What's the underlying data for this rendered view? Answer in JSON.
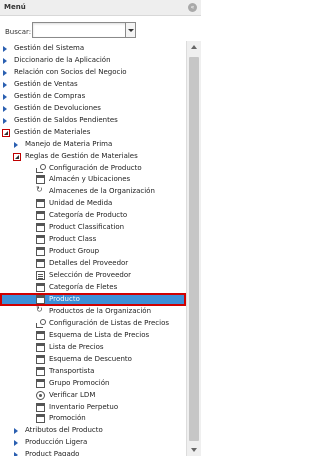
{
  "panel": {
    "title": "Menú",
    "collapse_icon": "«"
  },
  "search": {
    "label": "Buscar:",
    "value": ""
  },
  "tree": [
    {
      "label": "Gestión del Sistema",
      "kind": "folder",
      "level": 0,
      "icon": "arrow-right"
    },
    {
      "label": "Diccionario de la Aplicación",
      "kind": "folder",
      "level": 0,
      "icon": "arrow-right"
    },
    {
      "label": "Relación con Socios del Negocio",
      "kind": "folder",
      "level": 0,
      "icon": "arrow-right"
    },
    {
      "label": "Gestión de Ventas",
      "kind": "folder",
      "level": 0,
      "icon": "arrow-right"
    },
    {
      "label": "Gestión de Compras",
      "kind": "folder",
      "level": 0,
      "icon": "arrow-right"
    },
    {
      "label": "Gestión de Devoluciones",
      "kind": "folder",
      "level": 0,
      "icon": "arrow-right"
    },
    {
      "label": "Gestión de Saldos Pendientes",
      "kind": "folder",
      "level": 0,
      "icon": "arrow-right"
    },
    {
      "label": "Gestión de Materiales",
      "kind": "folder-open",
      "level": 0,
      "icon": "arrow-down"
    },
    {
      "label": "Manejo de Materia Prima",
      "kind": "folder",
      "level": 1,
      "icon": "arrow-right"
    },
    {
      "label": "Reglas de Gestión de Materiales",
      "kind": "folder-open",
      "level": 1,
      "icon": "arrow-down"
    },
    {
      "label": "Configuración de Producto",
      "kind": "process",
      "level": 2,
      "icon": "process2"
    },
    {
      "label": "Almacén y Ubicaciones",
      "kind": "window",
      "level": 2,
      "icon": "window"
    },
    {
      "label": "Almacenes de la Organización",
      "kind": "window",
      "level": 2,
      "icon": "process"
    },
    {
      "label": "Unidad de Medida",
      "kind": "window",
      "level": 2,
      "icon": "window"
    },
    {
      "label": "Categoría de Producto",
      "kind": "window",
      "level": 2,
      "icon": "window"
    },
    {
      "label": "Product Classification",
      "kind": "window",
      "level": 2,
      "icon": "window"
    },
    {
      "label": "Product Class",
      "kind": "window",
      "level": 2,
      "icon": "window"
    },
    {
      "label": "Product Group",
      "kind": "window",
      "level": 2,
      "icon": "window"
    },
    {
      "label": "Detalles del Proveedor",
      "kind": "window",
      "level": 2,
      "icon": "window"
    },
    {
      "label": "Selección de Proveedor",
      "kind": "window",
      "level": 2,
      "icon": "report"
    },
    {
      "label": "Categoría de Fletes",
      "kind": "window",
      "level": 2,
      "icon": "window"
    },
    {
      "label": "Producto",
      "kind": "window",
      "level": 2,
      "icon": "window",
      "selected": true
    },
    {
      "label": "Productos de la Organización",
      "kind": "window",
      "level": 2,
      "icon": "process"
    },
    {
      "label": "Configuración de Listas de Precios",
      "kind": "process",
      "level": 2,
      "icon": "process2"
    },
    {
      "label": "Esquema de Lista de Precios",
      "kind": "window",
      "level": 2,
      "icon": "window"
    },
    {
      "label": "Lista de Precios",
      "kind": "window",
      "level": 2,
      "icon": "window"
    },
    {
      "label": "Esquema de Descuento",
      "kind": "window",
      "level": 2,
      "icon": "window"
    },
    {
      "label": "Transportista",
      "kind": "window",
      "level": 2,
      "icon": "window"
    },
    {
      "label": "Grupo Promoción",
      "kind": "window",
      "level": 2,
      "icon": "window"
    },
    {
      "label": "Verificar LDM",
      "kind": "workflow",
      "level": 2,
      "icon": "workflow"
    },
    {
      "label": "Inventario Perpetuo",
      "kind": "window",
      "level": 2,
      "icon": "window"
    },
    {
      "label": "Promoción",
      "kind": "window",
      "level": 2,
      "icon": "window"
    },
    {
      "label": "Atributos del Producto",
      "kind": "folder",
      "level": 1,
      "icon": "arrow-right"
    },
    {
      "label": "Producción Ligera",
      "kind": "folder",
      "level": 1,
      "icon": "arrow-right"
    },
    {
      "label": "Product Pagado",
      "kind": "folder",
      "level": 1,
      "icon": "arrow-right"
    }
  ]
}
